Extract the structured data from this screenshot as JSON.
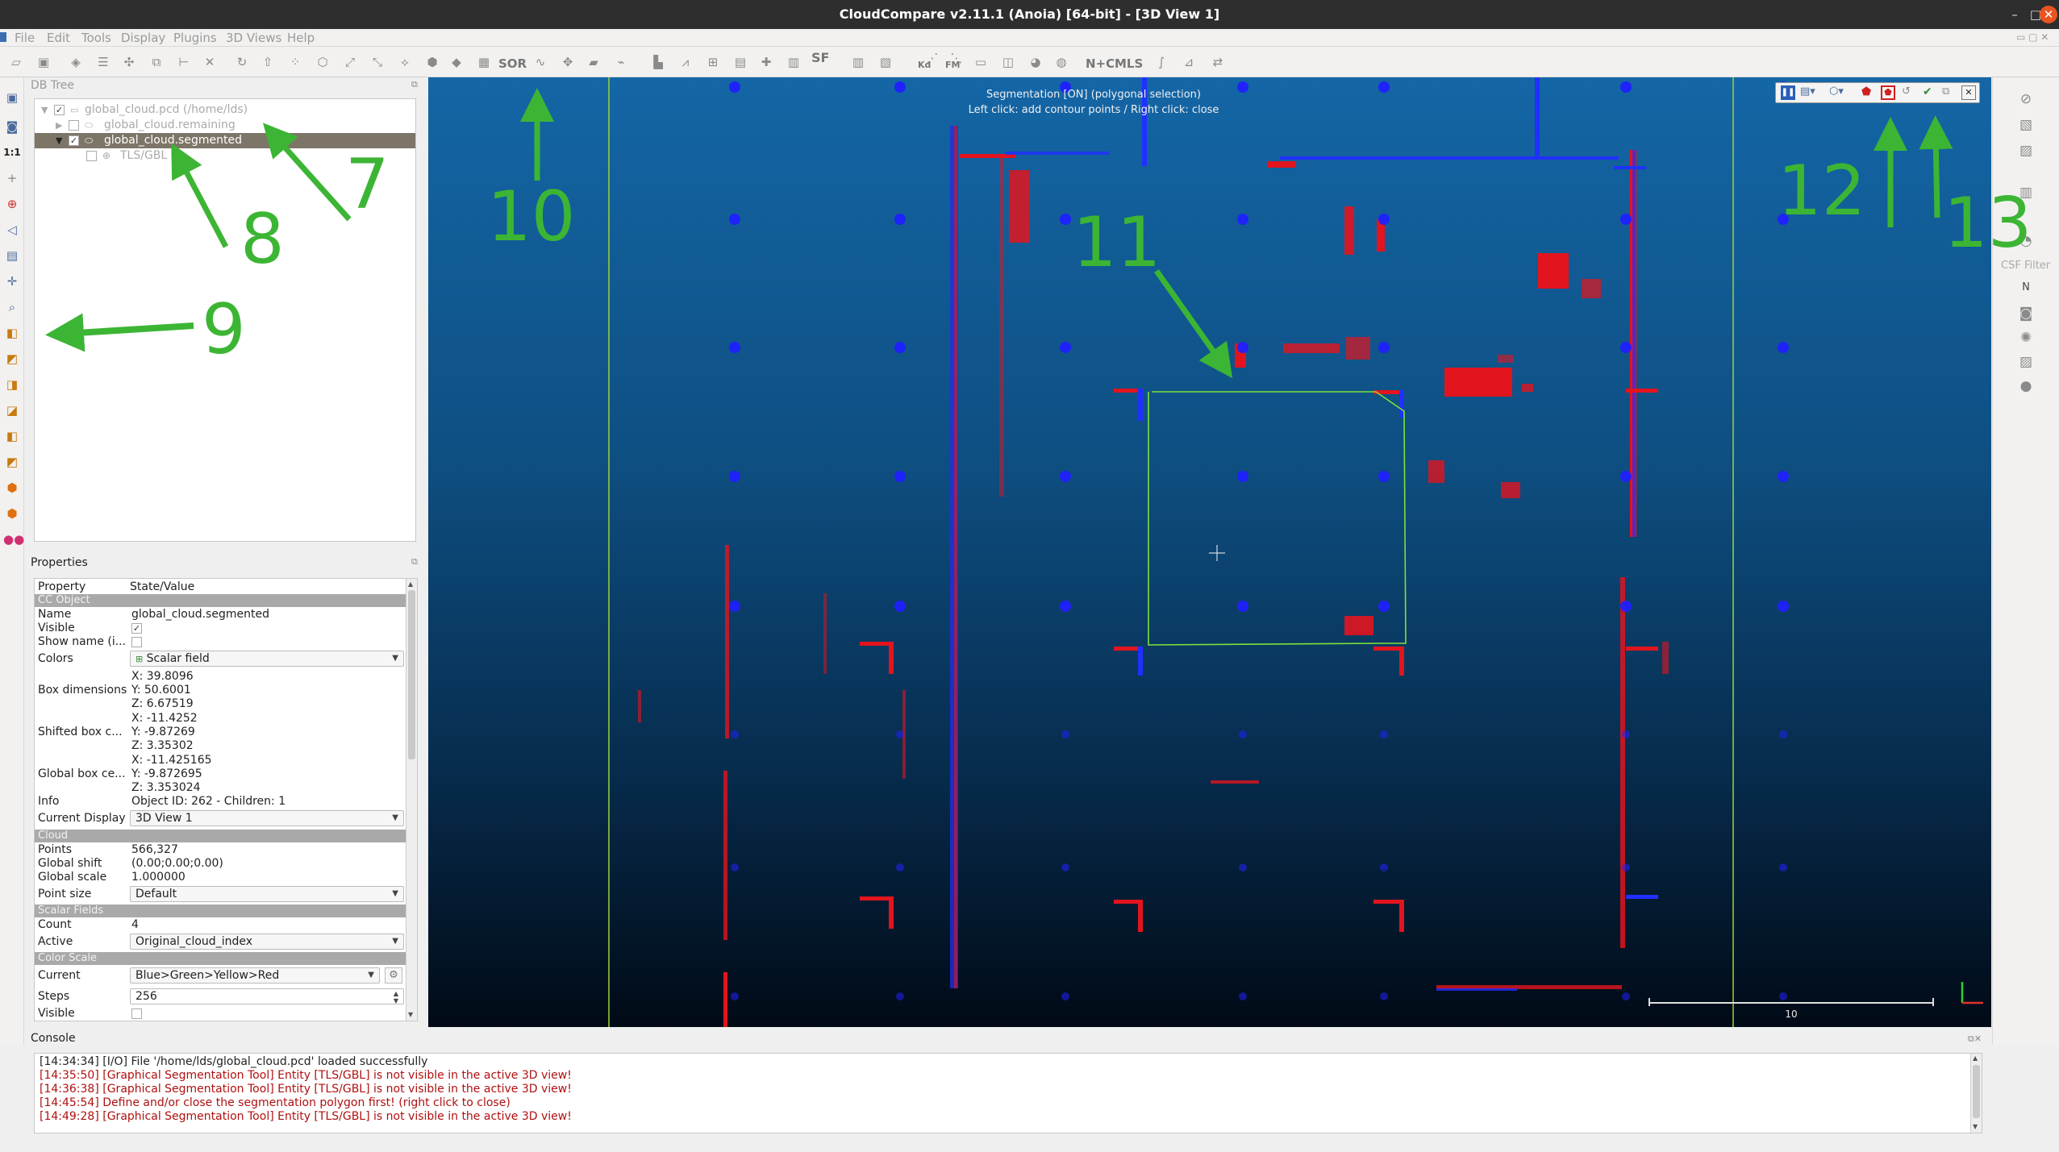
{
  "window": {
    "title": "CloudCompare v2.11.1 (Anoia) [64-bit] - [3D View 1]"
  },
  "menu": [
    "File",
    "Edit",
    "Tools",
    "Display",
    "Plugins",
    "3D Views",
    "Help"
  ],
  "toolbar": {
    "sor_label": "SOR",
    "sf_label": "SF",
    "kd_label": "Kd",
    "fm_label": "FM",
    "nc_label": "N+C",
    "mls_label": "MLS"
  },
  "left_toolbar": {
    "zoom_label": "1:1"
  },
  "right_toolbar": {
    "csf_label": "CSF Filter",
    "n_label": "N"
  },
  "db_tree": {
    "title": "DB Tree",
    "items": [
      {
        "label": "global_cloud.pcd (/home/lds)"
      },
      {
        "label": "global_cloud.remaining"
      },
      {
        "label": "global_cloud.segmented"
      },
      {
        "label": "TLS/GBL"
      }
    ]
  },
  "properties": {
    "title": "Properties",
    "header": {
      "property": "Property",
      "value": "State/Value"
    },
    "sections": {
      "cc_object": "CC Object",
      "cloud": "Cloud",
      "scalar_fields": "Scalar Fields",
      "color_scale": "Color Scale"
    },
    "name": {
      "key": "Name",
      "value": "global_cloud.segmented"
    },
    "visible": {
      "key": "Visible",
      "value": "✓"
    },
    "show_name": {
      "key": "Show name (i..."
    },
    "colors": {
      "key": "Colors",
      "value": "Scalar field"
    },
    "box_dimensions": {
      "key": "Box dimensions",
      "x": "X: 39.8096",
      "y": "Y: 50.6001",
      "z": "Z: 6.67519"
    },
    "shifted_box": {
      "key": "Shifted box c...",
      "x": "X: -11.4252",
      "y": "Y: -9.87269",
      "z": "Z: 3.35302"
    },
    "global_box": {
      "key": "Global box ce...",
      "x": "X: -11.425165",
      "y": "Y: -9.872695",
      "z": "Z: 3.353024"
    },
    "info": {
      "key": "Info",
      "value": "Object ID: 262 - Children: 1"
    },
    "current_display": {
      "key": "Current Display",
      "value": "3D View 1"
    },
    "points": {
      "key": "Points",
      "value": "566,327"
    },
    "global_shift": {
      "key": "Global shift",
      "value": "(0.00;0.00;0.00)"
    },
    "global_scale": {
      "key": "Global scale",
      "value": "1.000000"
    },
    "point_size": {
      "key": "Point size",
      "value": "Default"
    },
    "count": {
      "key": "Count",
      "value": "4"
    },
    "active": {
      "key": "Active",
      "value": "Original_cloud_index"
    },
    "current": {
      "key": "Current",
      "value": "Blue>Green>Yellow>Red"
    },
    "steps": {
      "key": "Steps",
      "value": "256"
    },
    "visible2": {
      "key": "Visible"
    }
  },
  "view": {
    "overlay_line1": "Segmentation [ON] (polygonal selection)",
    "overlay_line2": "Left click: add contour points / Right click: close",
    "scale_value": "10"
  },
  "console": {
    "title": "Console",
    "lines": [
      {
        "text": "[14:34:34] [I/O] File '/home/lds/global_cloud.pcd' loaded successfully",
        "color": "#222222"
      },
      {
        "text": "[14:35:50] [Graphical Segmentation Tool] Entity [TLS/GBL] is not visible in the active 3D view!",
        "color": "#b01010"
      },
      {
        "text": "[14:36:38] [Graphical Segmentation Tool] Entity [TLS/GBL] is not visible in the active 3D view!",
        "color": "#b01010"
      },
      {
        "text": "[14:45:54] Define and/or close the segmentation polygon first! (right click to close)",
        "color": "#b01010"
      },
      {
        "text": "[14:49:28] [Graphical Segmentation Tool] Entity [TLS/GBL] is not visible in the active 3D view!",
        "color": "#b01010"
      }
    ]
  },
  "annotations": [
    "7",
    "8",
    "9",
    "10",
    "11",
    "12",
    "13"
  ],
  "colors": {
    "annotation": "#3cb534",
    "point_red": "#e2141e",
    "point_blue": "#2020ff",
    "polygon": "#7fe03a"
  }
}
